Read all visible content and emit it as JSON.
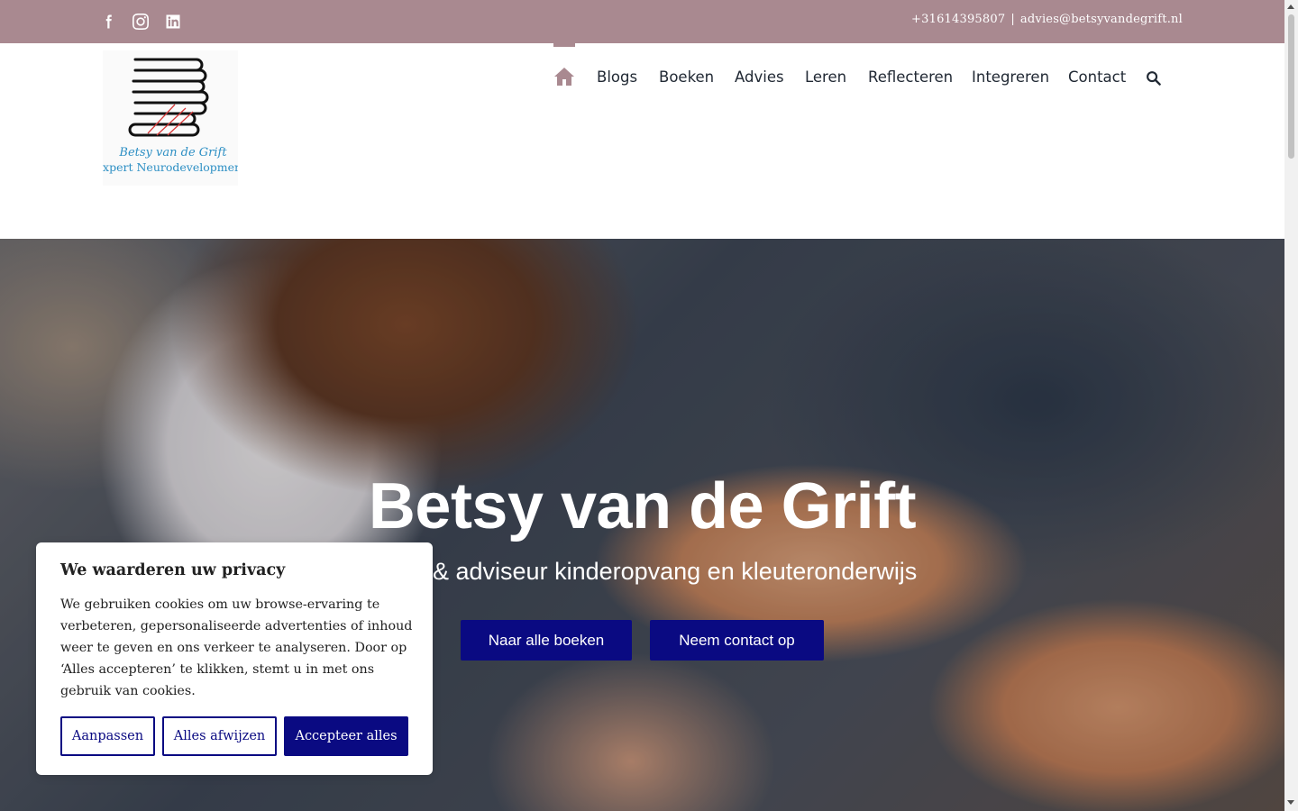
{
  "topbar": {
    "social": [
      {
        "icon": "facebook-icon"
      },
      {
        "icon": "instagram-icon"
      },
      {
        "icon": "linkedin-icon"
      }
    ],
    "phone": "+31614395807",
    "separator": "|",
    "email": "advies@betsyvandegrift.nl"
  },
  "logo": {
    "name": "Betsy van de Grift",
    "tagline": "Expert Neurodevelopment"
  },
  "nav": {
    "home_icon": "home-icon",
    "items": [
      "Blogs",
      "Boeken",
      "Advies",
      "Leren",
      "Reflecteren",
      "Integreren",
      "Contact"
    ],
    "search_icon": "search-icon"
  },
  "hero": {
    "title": "Betsy van de Grift",
    "subtitle": "& adviseur kinderopvang en kleuteronderwijs",
    "buttons": [
      "Naar alle boeken",
      "Neem contact op"
    ]
  },
  "cookie": {
    "title": "We waarderen uw privacy",
    "text": "We gebruiken cookies om uw browse-ervaring te verbeteren, gepersonaliseerde advertenties of inhoud weer te geven en ons verkeer te analyseren. Door op ‘Alles accepteren’ te klikken, stemt u in met ons gebruik van cookies.",
    "customize": "Aanpassen",
    "reject": "Alles afwijzen",
    "accept": "Accepteer alles"
  },
  "colors": {
    "topbar": "#a98990",
    "accent": "#0a0a82",
    "nav_text": "#212934"
  }
}
